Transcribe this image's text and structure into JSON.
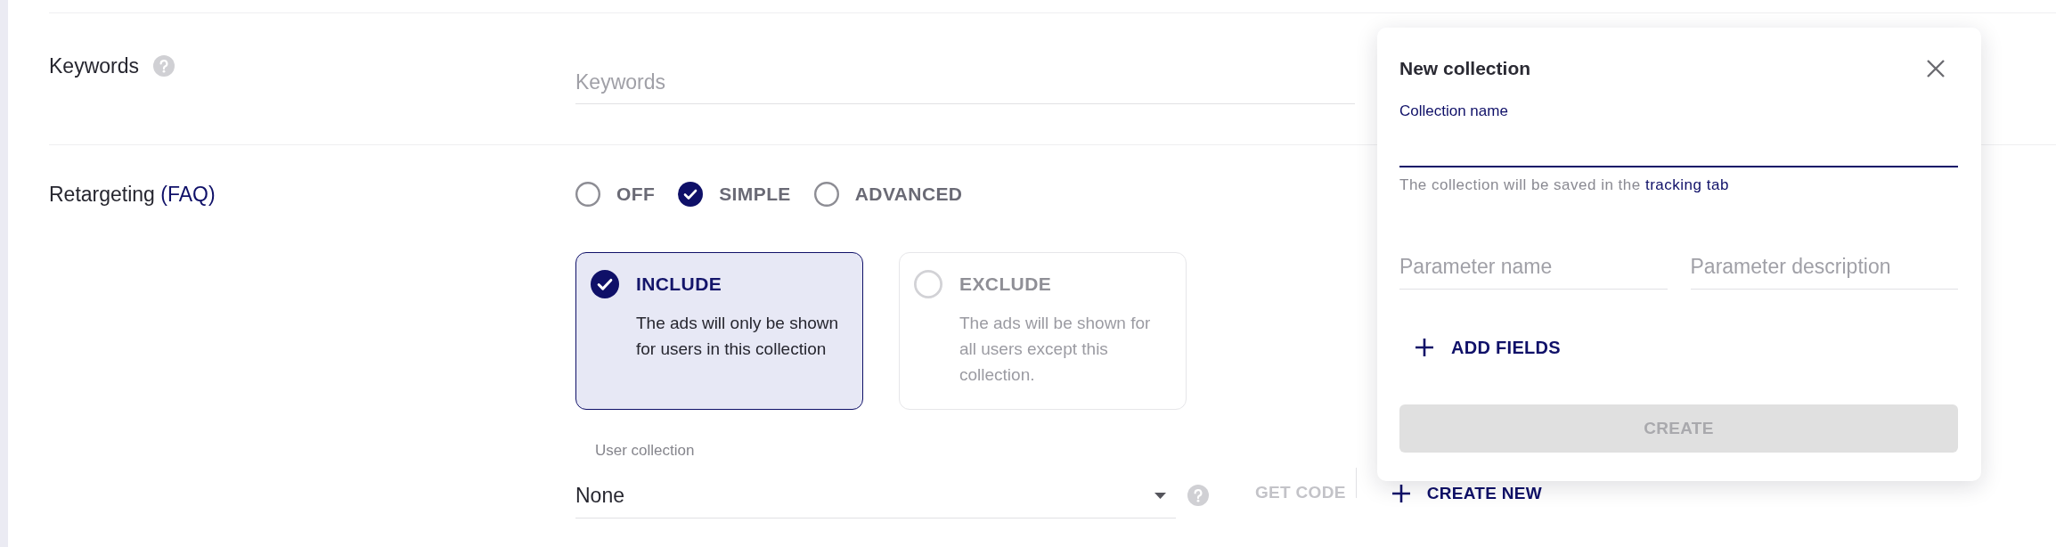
{
  "keywords": {
    "label": "Keywords",
    "placeholder": "Keywords"
  },
  "retargeting": {
    "label": "Retargeting",
    "link": "(FAQ)",
    "modes": [
      {
        "label": "OFF",
        "selected": false
      },
      {
        "label": "SIMPLE",
        "selected": true
      },
      {
        "label": "ADVANCED",
        "selected": false
      }
    ],
    "options": [
      {
        "title": "INCLUDE",
        "description": "The ads will only be shown for users in this collection",
        "selected": true
      },
      {
        "title": "EXCLUDE",
        "description": "The ads will be shown for all users except this collection.",
        "selected": false
      }
    ],
    "user_collection": {
      "label": "User collection",
      "value": "None"
    },
    "get_code": {
      "label": "GET CODE",
      "disabled": true
    },
    "create_new": {
      "label": "CREATE NEW"
    }
  },
  "new_collection": {
    "title": "New collection",
    "name_field": {
      "label": "Collection name",
      "focused": true
    },
    "helper": {
      "text": "The collection will be saved in the",
      "link": "tracking tab"
    },
    "parameters": [
      {
        "placeholder": "Parameter name"
      },
      {
        "placeholder": "Parameter description"
      }
    ],
    "add_fields": {
      "label": "ADD FIELDS"
    },
    "create_button": {
      "label": "CREATE",
      "disabled": true
    }
  }
}
